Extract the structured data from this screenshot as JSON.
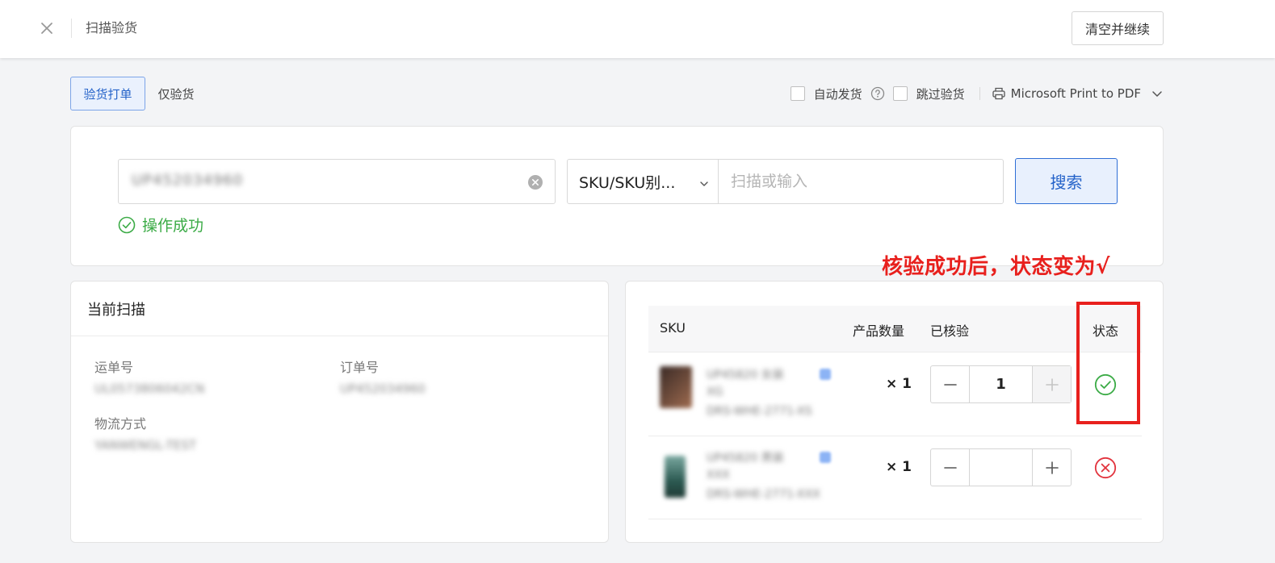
{
  "header": {
    "title": "扫描验货",
    "clear_button": "清空并继续"
  },
  "mode_tabs": [
    {
      "label": "验货打单",
      "active": true
    },
    {
      "label": "仅验货",
      "active": false
    }
  ],
  "options": {
    "auto_ship_label": "自动发货",
    "skip_check_label": "跳过验货",
    "printer": "Microsoft Print to PDF"
  },
  "search": {
    "scan_value": "UP452034960",
    "type_select": "SKU/SKU别...",
    "keyword_placeholder": "扫描或输入",
    "button": "搜索",
    "success_message": "操作成功"
  },
  "annotation": "核验成功后，状态变为√",
  "current_scan": {
    "title": "当前扫描",
    "tracking_label": "运单号",
    "tracking_value": "UL0573806042CN",
    "order_label": "订单号",
    "order_value": "UP452034960",
    "shipping_label": "物流方式",
    "shipping_value": "YANWENGL-TEST"
  },
  "sku_table": {
    "columns": [
      "SKU",
      "产品数量",
      "已核验",
      "状态"
    ],
    "rows": [
      {
        "name": "UP45820 女装",
        "sub": "XG",
        "code": "DRS-WHE-2771-XS",
        "qty": "× 1",
        "verified": "1",
        "status": "success"
      },
      {
        "name": "UP45820 男装",
        "sub": "XXX",
        "code": "DRS-WHE-2771-XXX",
        "qty": "× 1",
        "verified": "",
        "status": "error"
      }
    ]
  },
  "colors": {
    "accent": "#2563c9",
    "success": "#3bab46",
    "error": "#e2333d",
    "annotation": "#e8201d"
  }
}
